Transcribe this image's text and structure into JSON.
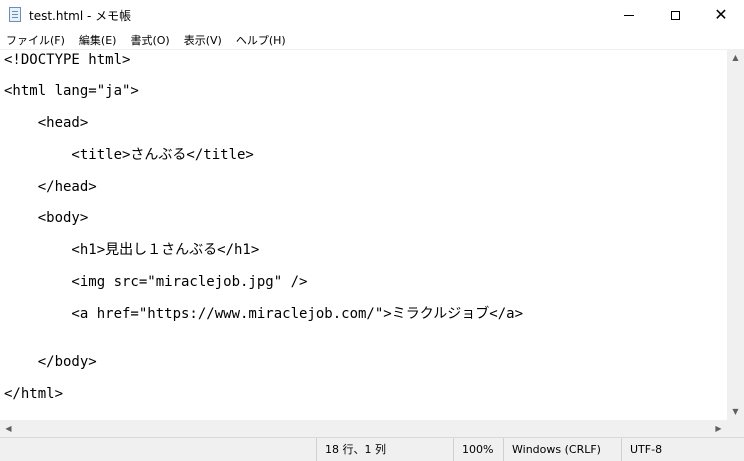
{
  "window": {
    "title": "test.html - メモ帳",
    "icon": "notepad-icon",
    "controls": {
      "minimize": "minimize-icon",
      "maximize": "maximize-icon",
      "close": "✕"
    }
  },
  "menu": {
    "items": [
      "ファイル(F)",
      "編集(E)",
      "書式(O)",
      "表示(V)",
      "ヘルプ(H)"
    ]
  },
  "editor": {
    "lines": [
      "<!DOCTYPE html>",
      "<html lang=\"ja\">",
      "    <head>",
      "        <title>さんぶる</title>",
      "    </head>",
      "    <body>",
      "        <h1>見出し１さんぶる</h1>",
      "        <img src=\"miraclejob.jpg\" />",
      "        <a href=\"https://www.miraclejob.com/\">ミラクルジョブ</a>",
      "",
      "    </body>",
      "</html>"
    ]
  },
  "scrollbars": {
    "up": "▲",
    "down": "▼",
    "left": "◀",
    "right": "▶"
  },
  "status": {
    "position": "18 行、1 列",
    "zoom": "100%",
    "line_ending": "Windows (CRLF)",
    "encoding": "UTF-8"
  }
}
